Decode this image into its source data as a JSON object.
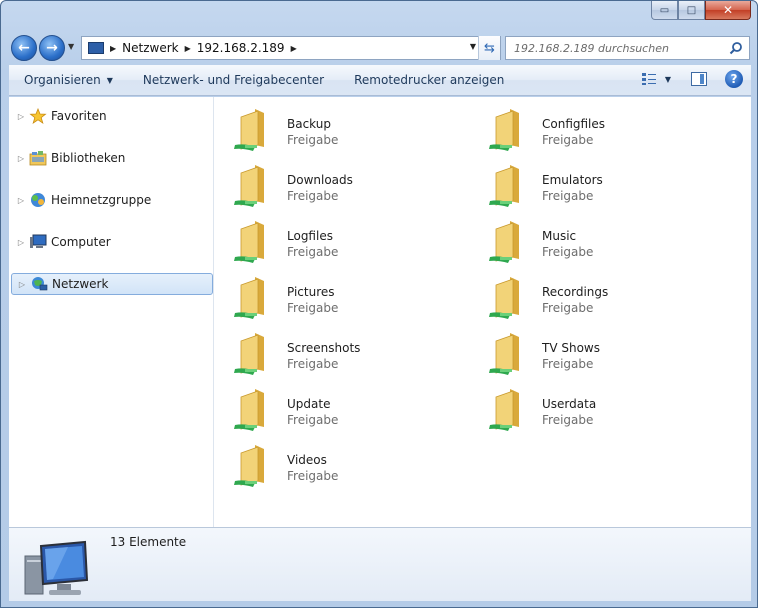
{
  "window": {
    "buttons": {
      "minimize": "▭",
      "maximize": "□",
      "close": "✕"
    }
  },
  "address_bar": {
    "breadcrumbs": [
      "Netzwerk",
      "192.168.2.189"
    ],
    "search_placeholder": "192.168.2.189 durchsuchen"
  },
  "toolbar": {
    "organize_label": "Organisieren",
    "network_center_label": "Netzwerk- und Freigabecenter",
    "remote_printer_label": "Remotedrucker anzeigen"
  },
  "sidebar": {
    "items": [
      {
        "label": "Favoriten",
        "icon": "star-icon"
      },
      {
        "label": "Bibliotheken",
        "icon": "libraries-icon"
      },
      {
        "label": "Heimnetzgruppe",
        "icon": "homegroup-icon"
      },
      {
        "label": "Computer",
        "icon": "computer-icon"
      },
      {
        "label": "Netzwerk",
        "icon": "network-icon",
        "selected": true
      }
    ]
  },
  "shares": [
    {
      "name": "Backup",
      "type": "Freigabe"
    },
    {
      "name": "Configfiles",
      "type": "Freigabe"
    },
    {
      "name": "Downloads",
      "type": "Freigabe"
    },
    {
      "name": "Emulators",
      "type": "Freigabe"
    },
    {
      "name": "Logfiles",
      "type": "Freigabe"
    },
    {
      "name": "Music",
      "type": "Freigabe"
    },
    {
      "name": "Pictures",
      "type": "Freigabe"
    },
    {
      "name": "Recordings",
      "type": "Freigabe"
    },
    {
      "name": "Screenshots",
      "type": "Freigabe"
    },
    {
      "name": "TV Shows",
      "type": "Freigabe"
    },
    {
      "name": "Update",
      "type": "Freigabe"
    },
    {
      "name": "Userdata",
      "type": "Freigabe"
    },
    {
      "name": "Videos",
      "type": "Freigabe"
    }
  ],
  "details": {
    "count_text": "13 Elemente"
  },
  "colors": {
    "folder": "#f2d378",
    "share_pipe": "#2fa84f",
    "selection": "#d2e4f8"
  }
}
